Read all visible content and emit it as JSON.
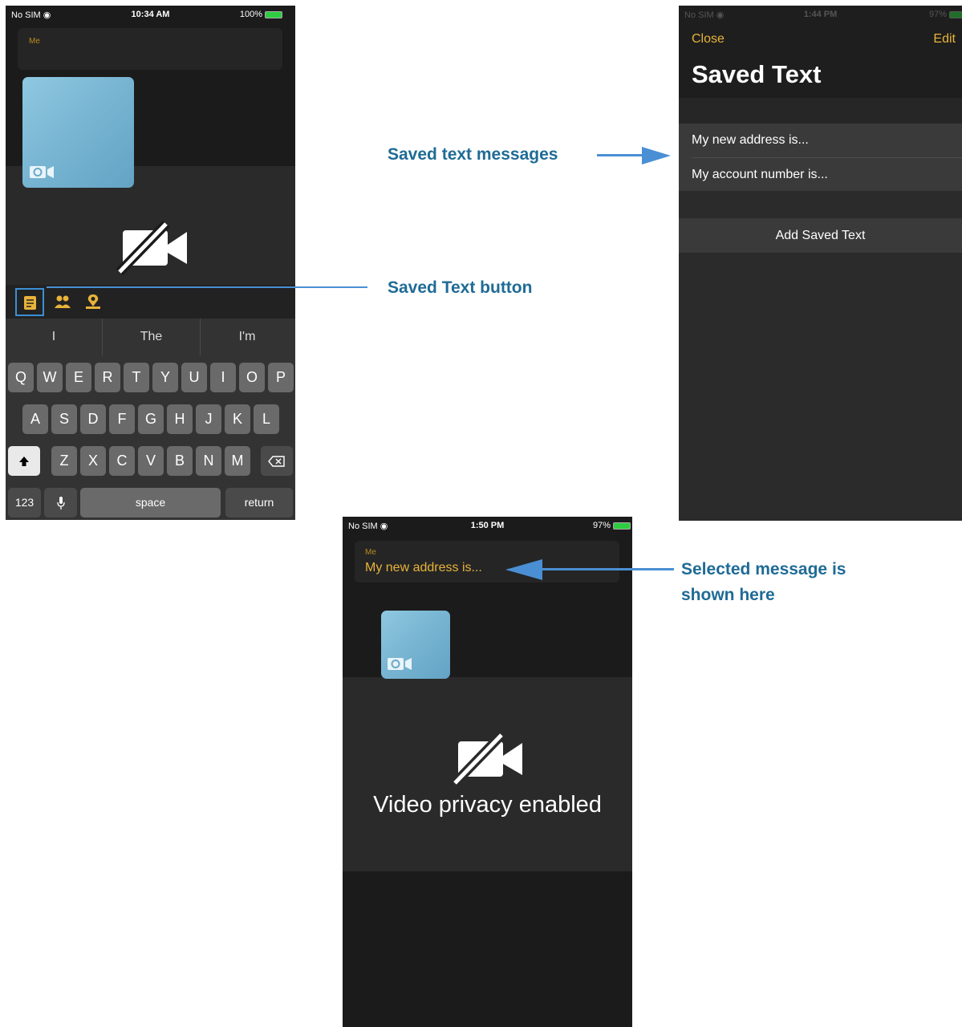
{
  "screen1": {
    "status": {
      "carrier": "No SIM",
      "time": "10:34 AM",
      "battery": "100%"
    },
    "message_sender": "Me",
    "toolbar_icons": [
      "saved-text-icon",
      "contacts-icon",
      "location-icon"
    ],
    "suggestions": [
      "I",
      "The",
      "I'm"
    ],
    "keys_row1": [
      "Q",
      "W",
      "E",
      "R",
      "T",
      "Y",
      "U",
      "I",
      "O",
      "P"
    ],
    "keys_row2": [
      "A",
      "S",
      "D",
      "F",
      "G",
      "H",
      "J",
      "K",
      "L"
    ],
    "keys_row3": [
      "Z",
      "X",
      "C",
      "V",
      "B",
      "N",
      "M"
    ],
    "key_123": "123",
    "key_space": "space",
    "key_return": "return"
  },
  "screen2": {
    "status": {
      "carrier": "No SIM",
      "time": "1:44 PM",
      "battery": "97%"
    },
    "close_label": "Close",
    "edit_label": "Edit",
    "title": "Saved Text",
    "saved_items": [
      "My new address is...",
      "My account number is..."
    ],
    "add_label": "Add Saved Text"
  },
  "screen3": {
    "status": {
      "carrier": "No SIM",
      "time": "1:50 PM",
      "battery": "97%"
    },
    "message_sender": "Me",
    "message_text": "My new address is...",
    "privacy_text": "Video privacy enabled"
  },
  "annotations": {
    "saved_text_messages": "Saved text messages",
    "saved_text_button": "Saved Text button",
    "selected_line1": "Selected message is",
    "selected_line2": "shown here"
  },
  "colors": {
    "accent": "#e8b33a",
    "annotation": "#1f6b96",
    "arrow": "#4a8fd4"
  }
}
